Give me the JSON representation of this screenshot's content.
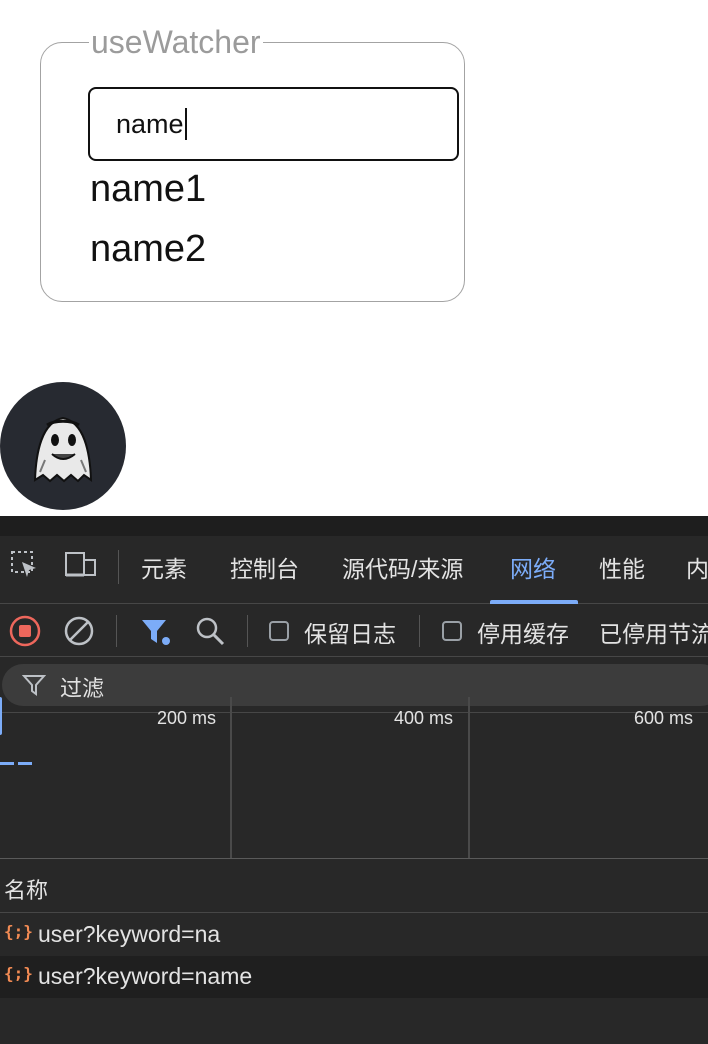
{
  "page": {
    "fieldset_legend": "useWatcher",
    "search_value": "name",
    "results": [
      "name1",
      "name2"
    ]
  },
  "devtools": {
    "tabs": [
      "元素",
      "控制台",
      "源代码/来源",
      "网络",
      "性能",
      "内"
    ],
    "active_tab": "网络",
    "toolbar": {
      "preserve_log_label": "保留日志",
      "disable_cache_label": "停用缓存",
      "throttling_label": "已停用节流"
    },
    "filter_placeholder": "过滤",
    "timeline_labels": [
      "200 ms",
      "400 ms",
      "600 ms"
    ],
    "column_header": "名称",
    "requests": [
      {
        "icon": "{;}",
        "name": "user?keyword=na"
      },
      {
        "icon": "{;}",
        "name": "user?keyword=name"
      }
    ],
    "colors": {
      "accent": "#7cacf8",
      "record": "#ee675c",
      "json_icon": "#f28b54",
      "background": "#282828"
    }
  }
}
